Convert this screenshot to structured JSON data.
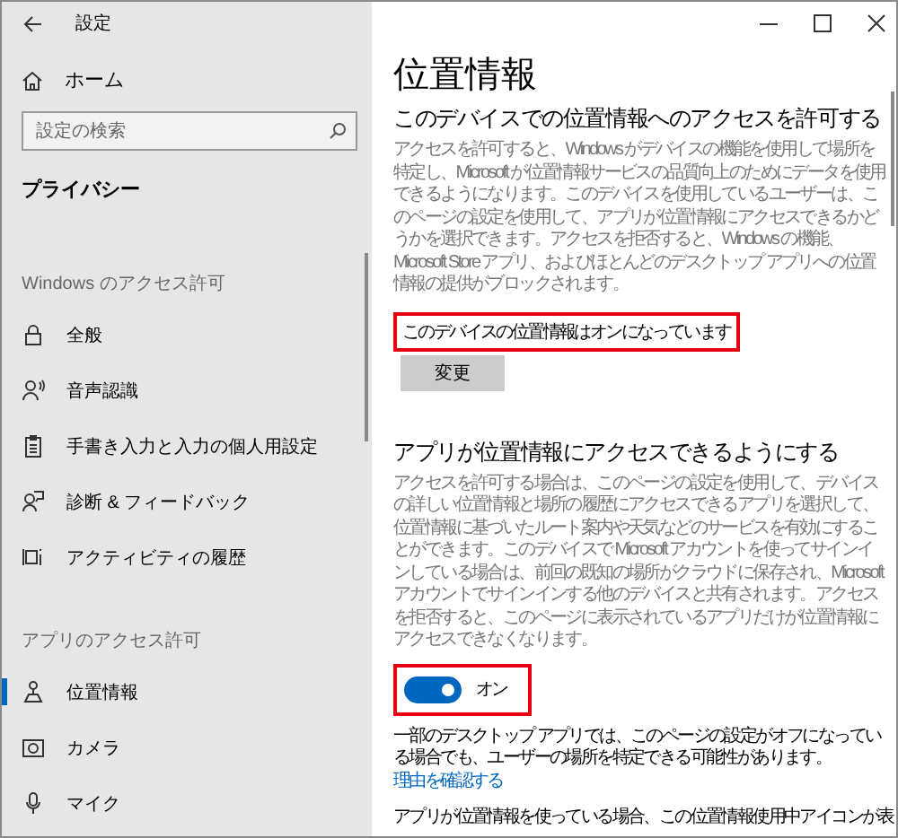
{
  "window": {
    "title": "設定"
  },
  "sidebar": {
    "home": "ホーム",
    "search": {
      "placeholder": "設定の検索"
    },
    "category": "プライバシー",
    "groups": [
      {
        "title": "Windows のアクセス許可",
        "items": [
          {
            "label": "全般",
            "selected": false
          },
          {
            "label": "音声認識",
            "selected": false
          },
          {
            "label": "手書き入力と入力の個人用設定",
            "selected": false
          },
          {
            "label": "診断 & フィードバック",
            "selected": false
          },
          {
            "label": "アクティビティの履歴",
            "selected": false
          }
        ]
      },
      {
        "title": "アプリのアクセス許可",
        "items": [
          {
            "label": "位置情報",
            "selected": true
          },
          {
            "label": "カメラ",
            "selected": false
          },
          {
            "label": "マイク",
            "selected": false
          }
        ]
      }
    ]
  },
  "main": {
    "title": "位置情報",
    "section1": {
      "heading": "このデバイスでの位置情報へのアクセスを許可する",
      "body": "アクセスを許可すると、Windows がデバイスの機能を使用して場所を特定し、Microsoft が位置情報サービスの品質向上のためにデータを使用できるようになります。このデバイスを使用しているユーザーは、このページの設定を使用して、アプリが位置情報にアクセスできるかどうかを選択できます。アクセスを拒否すると、Windows の機能、Microsoft Store アプリ、およびほとんどのデスクトップ アプリへの位置情報の提供がブロックされます。"
    },
    "device_status": {
      "text": "このデバイスの位置情報はオンになっています",
      "highlighted": true
    },
    "change_button": "変更",
    "section2": {
      "heading": "アプリが位置情報にアクセスできるようにする",
      "body": "アクセスを許可する場合は、このページの設定を使用して、デバイスの詳しい位置情報と場所の履歴にアクセスできるアプリを選択して、位置情報に基づいたルート案内や天気などのサービスを有効にすることができます。このデバイスで Microsoft アカウントを使ってサインインしている場合は、前回の既知の場所がクラウドに保存され、Microsoft アカウントでサインインする他のデバイスと共有されます。アクセスを拒否すると、このページに表示されているアプリだけが位置情報にアクセスできなくなります。"
    },
    "toggle": {
      "on": true,
      "label": "オン",
      "highlighted": true
    },
    "note": {
      "text": "一部のデスクトップ アプリでは、このページの設定がオフになっている場合でも、ユーザーの場所を特定できる可能性があります。",
      "link": "理由を確認する"
    },
    "footer_text": "アプリが位置情報を使っている場合、この位置情報使用中アイコンが表"
  }
}
